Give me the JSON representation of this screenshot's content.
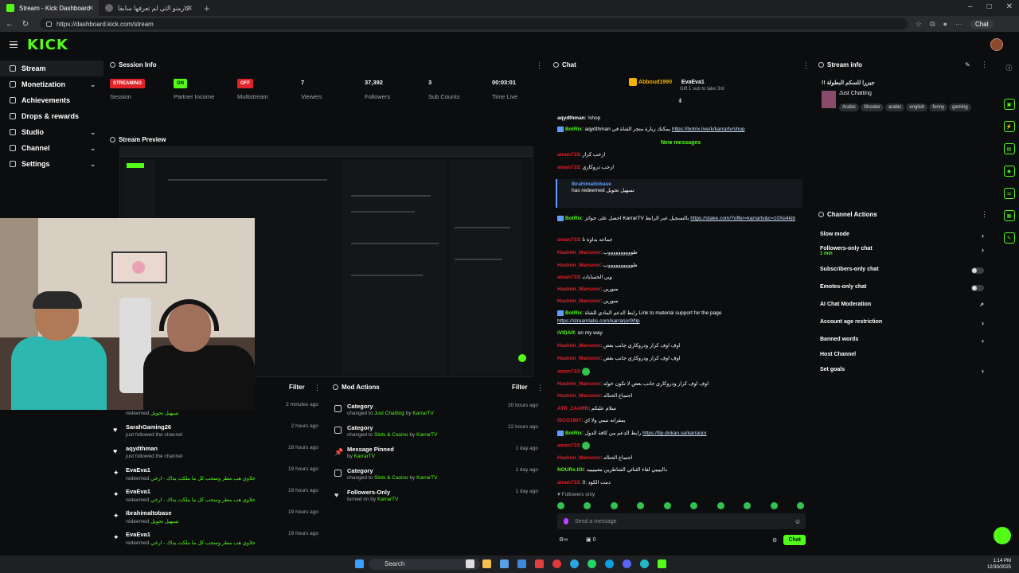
{
  "browser": {
    "tab1": "Stream - Kick Dashboard",
    "tab2": "أتعاب الكارمنو التي لم تعرفها سابقاً ...",
    "url": "https://dashboard.kick.com/stream",
    "chat_label": "Chat"
  },
  "sidebar": {
    "items": [
      {
        "label": "Stream"
      },
      {
        "label": "Monetization"
      },
      {
        "label": "Achievements"
      },
      {
        "label": "Drops & rewards"
      },
      {
        "label": "Studio"
      },
      {
        "label": "Channel"
      },
      {
        "label": "Settings"
      }
    ]
  },
  "session": {
    "title": "Session Info",
    "stats": [
      {
        "value": "STREAMING",
        "label": "Session"
      },
      {
        "value": "ON",
        "label": "Partner Income"
      },
      {
        "value": "OFF",
        "label": "Multistream"
      },
      {
        "value": "7",
        "label": "Viewers"
      },
      {
        "value": "37,392",
        "label": "Followers"
      },
      {
        "value": "3",
        "label": "Sub Counts"
      },
      {
        "value": "00:03:01",
        "label": "Time Live"
      }
    ]
  },
  "preview": {
    "title": "Stream Preview"
  },
  "activity": {
    "filter": "Filter",
    "rows": [
      {
        "name": "",
        "sub": "redeemed",
        "extra": "تسهيل تحويل",
        "time": "2 minutes ago"
      },
      {
        "name": "SarahGaming26",
        "sub": "just followed the channel",
        "extra": "",
        "time": "2 hours ago"
      },
      {
        "name": "aqydthman",
        "sub": "just followed the channel",
        "extra": "",
        "time": "18 hours ago"
      },
      {
        "name": "EvaEva1",
        "sub": "redeemed",
        "extra": "خلاوي هب مطر وسحب كل ما ملكت يداك - ارخي",
        "time": "19 hours ago"
      },
      {
        "name": "EvaEva1",
        "sub": "redeemed",
        "extra": "خلاوي هب مطر وسحب كل ما ملكت يداك - ارخي",
        "time": "19 hours ago"
      },
      {
        "name": "Ibrahimaltobase",
        "sub": "redeemed",
        "extra": "تسهيل تحويل",
        "time": "19 hours ago"
      },
      {
        "name": "EvaEva1",
        "sub": "redeemed",
        "extra": "خلاوي هب مطر وسحب كل ما ملكت يداك - ارخي",
        "time": "19 hours ago"
      }
    ]
  },
  "mod": {
    "title": "Mod Actions",
    "filter": "Filter",
    "rows": [
      {
        "name": "Category",
        "pre": "changed to",
        "val": "Just Chatting",
        "by": "by",
        "user": "KarrarTV",
        "time": "20 hours ago"
      },
      {
        "name": "Category",
        "pre": "changed to",
        "val": "Slots & Casino",
        "by": "by",
        "user": "KarrarTV",
        "time": "22 hours ago"
      },
      {
        "name": "Message Pinned",
        "pre": "by",
        "val": "KarrarTV",
        "by": "",
        "user": "",
        "time": "1 day ago"
      },
      {
        "name": "Category",
        "pre": "changed to",
        "val": "Slots & Casino",
        "by": "by",
        "user": "KarrarTV",
        "time": "1 day ago"
      },
      {
        "name": "Followers-Only",
        "pre": "turned on by",
        "val": "KarrarTV",
        "by": "",
        "user": "",
        "time": "1 day ago"
      }
    ]
  },
  "chat": {
    "title": "Chat",
    "pinned_user1": "Abboud1990",
    "pinned_user2": "EvaEva1",
    "gift_text": "Gift 1 sub to take 3rd",
    "new_messages": "New messages",
    "followers_only": "Followers only",
    "placeholder": "Send a message",
    "send": "Chat",
    "count": "0",
    "lines": [
      {
        "user": "aqydthman",
        "cls": "u-wht",
        "text": "!shop"
      },
      {
        "user": "BotRix",
        "cls": "u-grn",
        "text": "aqydthman يمكنك زيارة متجر القناة في",
        "link": "https://botrix.live/k/karrartv/shop"
      },
      {
        "user": "aman733",
        "cls": "u-red",
        "text": "ارحب كرار"
      },
      {
        "user": "aman733",
        "cls": "u-red",
        "text": "ارحب دروكاري"
      },
      {
        "user": "Ibrahimaltobase",
        "cls": "u-blu",
        "text": "has redeemed تسهيل تحويل"
      },
      {
        "user": "BotRix",
        "cls": "u-grn",
        "text": "احصل على جوائز KarrarTV بالتسجيل عبر الرابط",
        "link": "https://stake.com/?offer=karrartv&c=10Xe4kib"
      },
      {
        "user": "aman733",
        "cls": "u-red",
        "text": "جماعه بداوة تا"
      },
      {
        "user": "Hashim_Mansoor",
        "cls": "u-red",
        "text": "طووووووووووب"
      },
      {
        "user": "Hashim_Mansoor",
        "cls": "u-red",
        "text": "طووووووووووب"
      },
      {
        "user": "aman733",
        "cls": "u-red",
        "text": "وين الحسابات"
      },
      {
        "user": "Hashim_Mansoor",
        "cls": "u-red",
        "text": "منورين"
      },
      {
        "user": "Hashim_Mansoor",
        "cls": "u-red",
        "text": "منورين"
      },
      {
        "user": "BotRix",
        "cls": "u-grn",
        "text": "رابط الدعم المادي للقناة Link to material support for the page",
        "link": "https://streamlabs.com/karrarjor9/tip"
      },
      {
        "user": "iVIDAR",
        "cls": "u-grn",
        "text": "on my way"
      },
      {
        "user": "Hashim_Mansoor",
        "cls": "u-red",
        "text": "اوف اوف كرار ودروكاري جانب بعض"
      },
      {
        "user": "Hashim_Mansoor",
        "cls": "u-red",
        "text": "اوف اوف كرار ودروكاري جانب بعض"
      },
      {
        "user": "aman733",
        "cls": "u-red",
        "text": ""
      },
      {
        "user": "Hashim_Mansoor",
        "cls": "u-red",
        "text": "اوف اوف كرار ودروكاري جانب بعض لا تكون خوله"
      },
      {
        "user": "Hashim_Mansoor",
        "cls": "u-red",
        "text": "اجتماع الحتاله"
      },
      {
        "user": "ATR_ZAARR",
        "cls": "u-red",
        "text": "سلام عليكم"
      },
      {
        "user": "ISCO1907",
        "cls": "u-red",
        "text": "بمقرانه تيمي ولا اي"
      },
      {
        "user": "BotRix",
        "cls": "u-grn",
        "text": "رابط الدعم من كافة الدول",
        "link": "https://tip.dokan.sa/karrarjor"
      },
      {
        "user": "aman733",
        "cls": "u-red",
        "text": ""
      },
      {
        "user": "Hashim_Mansoor",
        "cls": "u-red",
        "text": "اجتماع الحتاله"
      },
      {
        "user": "NOURx.IOi",
        "cls": "u-grn",
        "text": "دااييييي لقاء الثنائي الشاطرين مفيييييد"
      },
      {
        "user": "aman733",
        "cls": "u-red",
        "text": "دمت الكود :0"
      }
    ]
  },
  "stream_info": {
    "title": "Stream info",
    "stream_title": "!! جيزرا للسكم البطولة",
    "category": "Just Chatting",
    "tags": [
      "Arabic",
      "Shooter",
      "arabic",
      "english",
      "funny",
      "gaming"
    ]
  },
  "channel_actions": {
    "title": "Channel Actions",
    "items": [
      {
        "label": "Slow mode",
        "kind": "chev",
        "sub": ""
      },
      {
        "label": "Followers-only chat",
        "kind": "chev",
        "sub": "1 min"
      },
      {
        "label": "Subscribers-only chat",
        "kind": "toggle",
        "sub": ""
      },
      {
        "label": "Emotes-only chat",
        "kind": "toggle",
        "sub": ""
      },
      {
        "label": "AI Chat Moderation",
        "kind": "ext",
        "sub": ""
      },
      {
        "label": "Account age restriction",
        "kind": "chev",
        "sub": ""
      },
      {
        "label": "Banned words",
        "kind": "chev",
        "sub": ""
      },
      {
        "label": "Host Channel",
        "kind": "none",
        "sub": ""
      },
      {
        "label": "Set goals",
        "kind": "chev",
        "sub": ""
      }
    ]
  },
  "taskbar": {
    "search": "Search",
    "time": "1:14 PM",
    "date": "12/30/2025"
  },
  "colors": {
    "accent": "#53fc18",
    "live": "#e0222a",
    "bg": "#0b0d0f"
  }
}
